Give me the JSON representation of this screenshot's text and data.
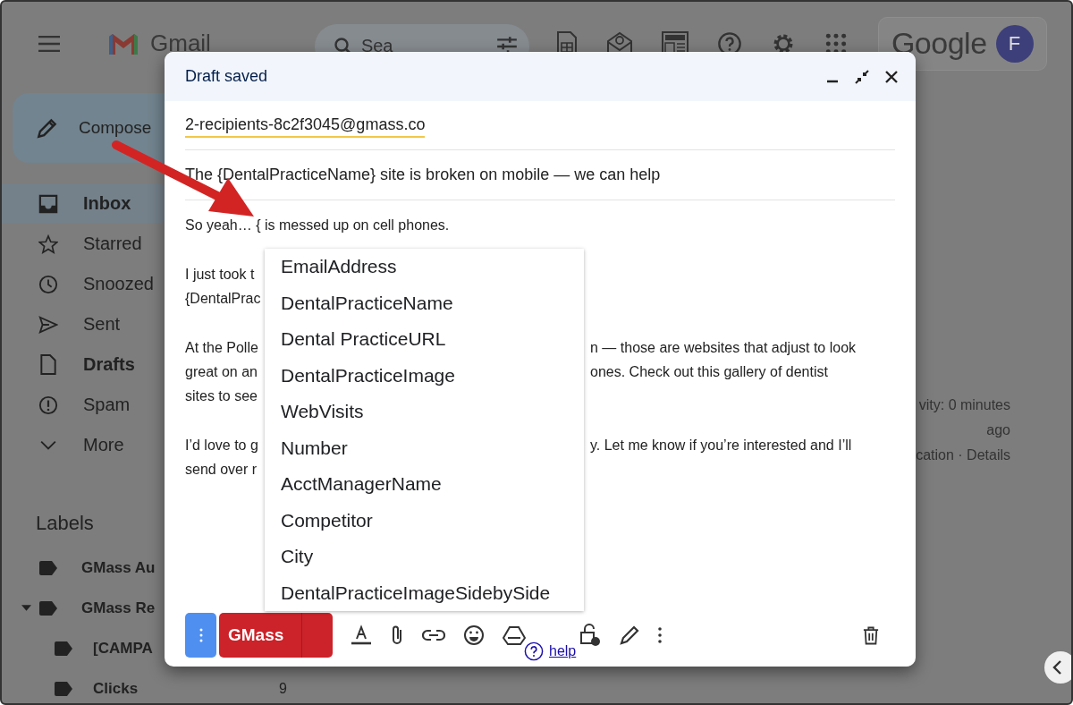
{
  "topbar": {
    "app_name": "Gmail",
    "search_placeholder": "Sea",
    "brand": "Google",
    "account_initial": "F"
  },
  "sidebar": {
    "compose": "Compose",
    "items": [
      {
        "label": "Inbox",
        "kind": "inbox",
        "selected": true,
        "unread": true
      },
      {
        "label": "Starred",
        "kind": "star",
        "selected": false,
        "unread": false
      },
      {
        "label": "Snoozed",
        "kind": "clock",
        "selected": false,
        "unread": false
      },
      {
        "label": "Sent",
        "kind": "send",
        "selected": false,
        "unread": false
      },
      {
        "label": "Drafts",
        "kind": "file",
        "selected": false,
        "unread": true
      },
      {
        "label": "Spam",
        "kind": "alert",
        "selected": false,
        "unread": false
      },
      {
        "label": "More",
        "kind": "chevron",
        "selected": false,
        "unread": false
      }
    ],
    "labels_heading": "Labels",
    "labels": [
      {
        "name": "GMass Au"
      },
      {
        "name": "GMass Re",
        "expanded": true,
        "children": [
          {
            "name": "[CAMPA"
          },
          {
            "name": "Clicks",
            "count": "9"
          }
        ]
      }
    ]
  },
  "details_panel": [
    "vity: 0 minutes",
    "ago",
    "cation · Details"
  ],
  "dialog": {
    "title": "Draft saved",
    "to": "2-recipients-8c2f3045@gmass.co",
    "subject": "The {DentalPracticeName} site is broken on mobile — we can help",
    "body": [
      {
        "lines": [
          {
            "left": "So yeah… { is messed up on cell phones."
          }
        ]
      },
      {
        "lines": [
          {
            "left": "I just took t"
          },
          {
            "left": "{DentalPrac"
          }
        ]
      },
      {
        "lines": [
          {
            "left": "At the Polle",
            "right": "n — those are websites that adjust to look"
          },
          {
            "left": "great on an",
            "right": "ones. Check out this gallery of dentist"
          },
          {
            "left": "sites to see"
          }
        ]
      },
      {
        "lines": [
          {
            "left": "I’d love to g",
            "right": "y. Let me know if you’re interested and I’ll"
          },
          {
            "left": "send over r"
          }
        ]
      }
    ],
    "autocomplete": [
      "EmailAddress",
      "DentalPracticeName",
      "Dental PracticeURL",
      "DentalPracticeImage",
      "WebVisits",
      "Number",
      "AcctManagerName",
      "Competitor",
      "City",
      "DentalPracticeImageSidebySide"
    ],
    "send_label": "GMass",
    "help_link": "help"
  }
}
